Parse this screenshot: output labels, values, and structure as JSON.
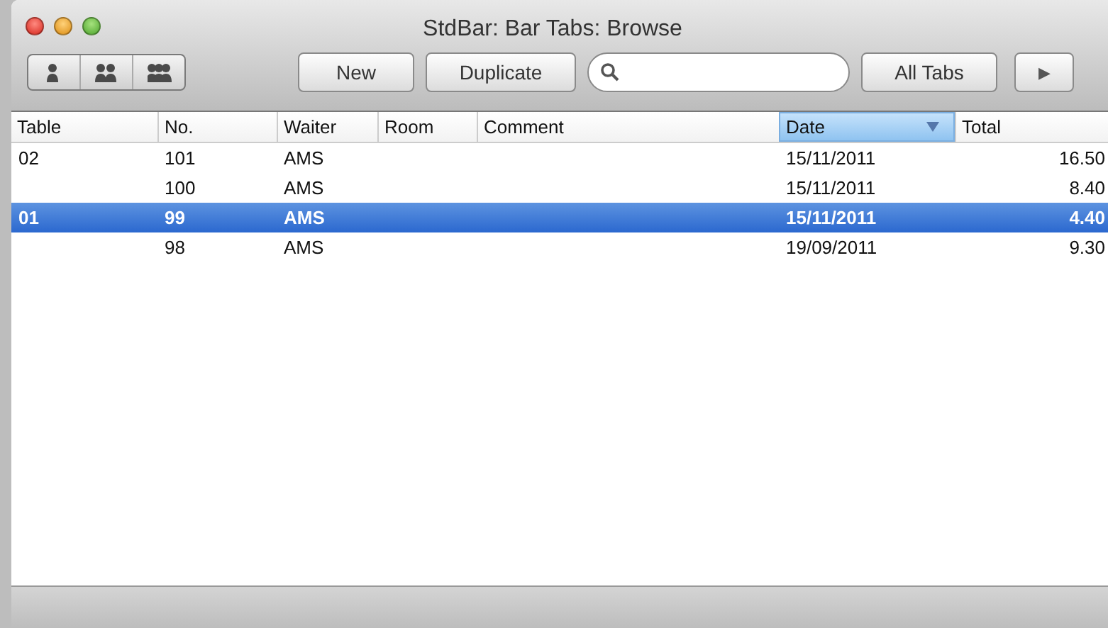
{
  "window": {
    "title": "StdBar: Bar Tabs: Browse"
  },
  "toolbar": {
    "buttons": [
      {
        "kind": "text",
        "label": "New"
      },
      {
        "kind": "text",
        "label": "Duplicate"
      },
      {
        "kind": "search"
      },
      {
        "kind": "text",
        "label": "All Tabs"
      },
      {
        "kind": "play",
        "label": "▶"
      }
    ]
  },
  "table": {
    "columns": [
      {
        "label": "Table",
        "sorted": false
      },
      {
        "label": "No.",
        "sorted": false
      },
      {
        "label": "Waiter",
        "sorted": false
      },
      {
        "label": "Room",
        "sorted": false
      },
      {
        "label": "Comment",
        "sorted": false
      },
      {
        "label": "Date",
        "sorted": true
      },
      {
        "label": "Total",
        "sorted": false
      }
    ],
    "rows": [
      {
        "cells": [
          "02",
          "101",
          "AMS",
          "",
          "",
          "15/11/2011",
          "16.50"
        ],
        "selected": false
      },
      {
        "cells": [
          "",
          "100",
          "AMS",
          "",
          "",
          "15/11/2011",
          "8.40"
        ],
        "selected": false
      },
      {
        "cells": [
          "01",
          "99",
          "AMS",
          "",
          "",
          "15/11/2011",
          "4.40"
        ],
        "selected": true
      },
      {
        "cells": [
          "",
          "98",
          "AMS",
          "",
          "",
          "19/09/2011",
          "9.30"
        ],
        "selected": false
      }
    ]
  }
}
